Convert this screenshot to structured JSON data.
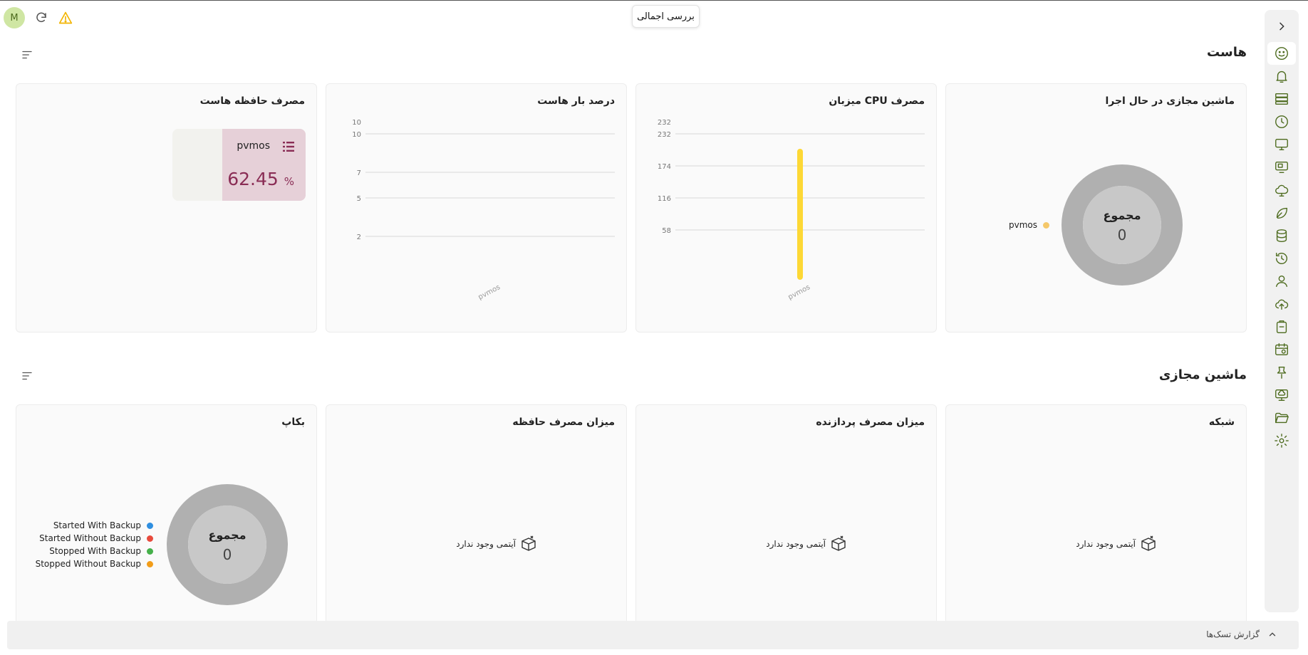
{
  "header": {
    "title": "بررسی اجمالی",
    "avatar_initial": "M"
  },
  "sidebar": {
    "items": [
      {
        "name": "dashboard-icon",
        "active": true
      },
      {
        "name": "bell-icon"
      },
      {
        "name": "server-icon"
      },
      {
        "name": "clock-icon"
      },
      {
        "name": "monitor-icon"
      },
      {
        "name": "monitor-copy-icon"
      },
      {
        "name": "cloud-icon"
      },
      {
        "name": "leaf-icon"
      },
      {
        "name": "database-icon"
      },
      {
        "name": "history-icon"
      },
      {
        "name": "user-icon"
      },
      {
        "name": "cloud-upload-icon"
      },
      {
        "name": "clipboard-icon"
      },
      {
        "name": "calendar-clock-icon"
      },
      {
        "name": "pin-icon"
      },
      {
        "name": "monitor-cloud-icon"
      },
      {
        "name": "folder-open-icon"
      },
      {
        "name": "settings-icon"
      }
    ]
  },
  "host_section": {
    "title": "هاست",
    "cards": {
      "running_vms": {
        "title": "ماشین مجازی در حال اجرا",
        "center_label": "مجموع",
        "center_value": "0",
        "legend": [
          {
            "label": "pvmos",
            "color": "#f5c86a"
          }
        ]
      },
      "cpu": {
        "title": "مصرف CPU میزبان"
      },
      "load": {
        "title": "درصد بار هاست"
      },
      "memory": {
        "title": "مصرف حافظه هاست",
        "host_name": "pvmos",
        "value": "62.45",
        "unit": "%"
      }
    }
  },
  "vm_section": {
    "title": "ماشین مجازی",
    "cards": {
      "network": {
        "title": "شبکه",
        "empty_text": "آیتمی وجود ندارد"
      },
      "cpu_usage": {
        "title": "میزان مصرف پردازنده",
        "empty_text": "آیتمی وجود ندارد"
      },
      "memory_usage": {
        "title": "میزان مصرف حافظه",
        "empty_text": "آیتمی وجود ندارد"
      },
      "backup": {
        "title": "بکاپ",
        "center_label": "مجموع",
        "center_value": "0",
        "legend": [
          {
            "label": "Started With Backup",
            "color": "#2f8fe0"
          },
          {
            "label": "Started Without Backup",
            "color": "#e84a3c"
          },
          {
            "label": "Stopped With Backup",
            "color": "#45b04a"
          },
          {
            "label": "Stopped Without Backup",
            "color": "#f29d19"
          }
        ]
      }
    }
  },
  "chart_data": [
    {
      "type": "bar",
      "title": "مصرف CPU میزبان",
      "categories": [
        "pvmos"
      ],
      "values": [
        205
      ],
      "yticks": [
        "58",
        "116",
        "174",
        "232"
      ],
      "ylim": [
        0,
        232
      ],
      "color": "#fdd835",
      "grid": true
    },
    {
      "type": "bar",
      "title": "درصد بار هاست",
      "categories": [
        "pvmos"
      ],
      "values": [
        0
      ],
      "yticks": [
        "2",
        "5",
        "7",
        "10"
      ],
      "ylim": [
        0,
        10
      ],
      "grid": true
    }
  ],
  "footer": {
    "task_report": "گزارش تسک‌ها"
  }
}
